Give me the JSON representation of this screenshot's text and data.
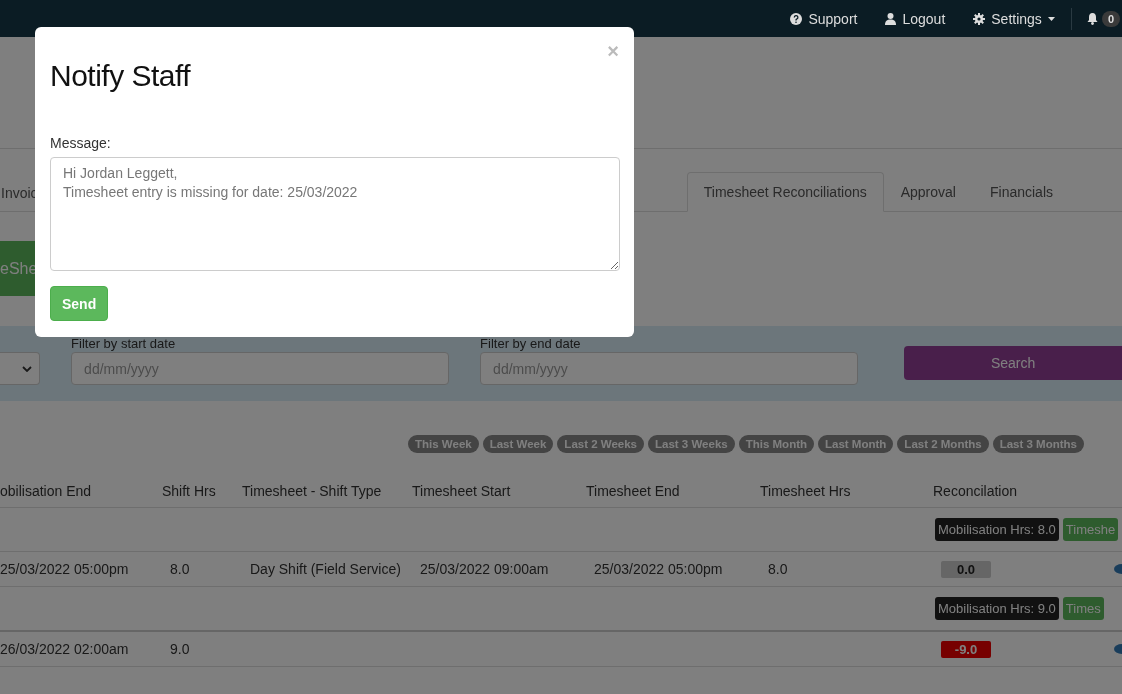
{
  "navbar": {
    "items": [
      {
        "kind": "support",
        "label": "Support"
      },
      {
        "kind": "logout",
        "label": "Logout"
      },
      {
        "kind": "settings",
        "label": "Settings"
      }
    ],
    "notifications": {
      "count": "0"
    }
  },
  "tabs": [
    {
      "label": "Invoic",
      "selected": false
    },
    {
      "label": "Timesheet Reconciliations",
      "selected": true
    },
    {
      "label": "Approval",
      "selected": false
    },
    {
      "label": "Financials",
      "selected": false
    }
  ],
  "action_button": "eShe",
  "filters": {
    "start_label": "Filter by start date",
    "start_placeholder": "dd/mm/yyyy",
    "end_label": "Filter by end date",
    "end_placeholder": "dd/mm/yyyy",
    "search_button": "Search"
  },
  "quick_ranges": [
    "This Week",
    "Last Week",
    "Last 2 Weeks",
    "Last 3 Weeks",
    "This Month",
    "Last Month",
    "Last 2 Months",
    "Last 3 Months"
  ],
  "table": {
    "columns": [
      "obilisation End",
      "Shift Hrs",
      "Timesheet - Shift Type",
      "Timesheet Start",
      "Timesheet End",
      "Timesheet Hrs",
      "Reconcilation"
    ],
    "rows": [
      {
        "kind": "summary",
        "badges": [
          {
            "kind": "mobilisation",
            "text": "Mobilisation Hrs: 8.0"
          },
          {
            "kind": "timesheet",
            "text": "Timeshe"
          }
        ]
      },
      {
        "kind": "entry",
        "cells": [
          "25/03/2022 05:00pm",
          "8.0",
          "Day Shift (Field Service)",
          "25/03/2022 09:00am",
          "25/03/2022 05:00pm",
          "8.0"
        ],
        "variance": {
          "kind": "zero",
          "text": "0.0"
        }
      },
      {
        "kind": "summary",
        "badges": [
          {
            "kind": "mobilisation",
            "text": "Mobilisation Hrs: 9.0"
          },
          {
            "kind": "timesheet",
            "text": "Times"
          }
        ]
      },
      {
        "kind": "entry",
        "cells": [
          "26/03/2022 02:00am",
          "9.0",
          null,
          null,
          null,
          null
        ],
        "variance": {
          "kind": "negative",
          "text": "-9.0"
        }
      }
    ]
  },
  "modal": {
    "title": "Notify Staff",
    "close": "×",
    "message_label": "Message:",
    "message": "Hi Jordan Leggett,\nTimesheet entry is missing for date: 25/03/2022",
    "send_button": "Send"
  }
}
